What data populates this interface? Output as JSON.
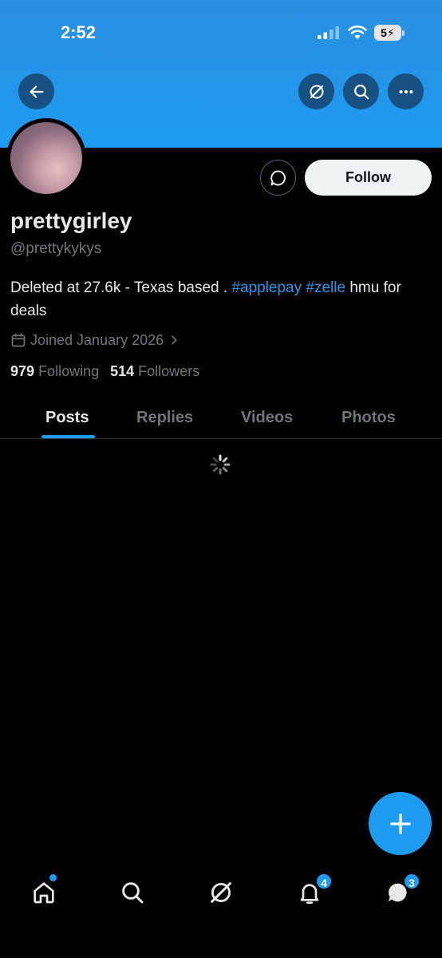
{
  "status_bar": {
    "time": "2:52",
    "battery": "5"
  },
  "profile": {
    "display_name": "prettygirley",
    "handle": "@prettykykys",
    "bio_text": "Deleted at 27.6k - Texas based . ",
    "bio_hashtags": [
      "#applepay",
      "#zelle"
    ],
    "bio_suffix": " hmu for deals",
    "joined": "Joined January 2026",
    "following_count": "979",
    "following_label": "Following",
    "followers_count": "514",
    "followers_label": "Followers"
  },
  "actions": {
    "follow_label": "Follow"
  },
  "tabs": [
    {
      "label": "Posts",
      "active": true
    },
    {
      "label": "Replies",
      "active": false
    },
    {
      "label": "Videos",
      "active": false
    },
    {
      "label": "Photos",
      "active": false
    }
  ],
  "bottom_nav": {
    "items": [
      "home-icon",
      "search-icon",
      "grok-icon",
      "bell-icon",
      "messages-icon"
    ],
    "notifications_badge": "4",
    "messages_badge": "3"
  },
  "colors": {
    "accent": "#1d9bf0",
    "background": "#000000",
    "text": "#e7e9ea",
    "muted": "#71767b"
  }
}
